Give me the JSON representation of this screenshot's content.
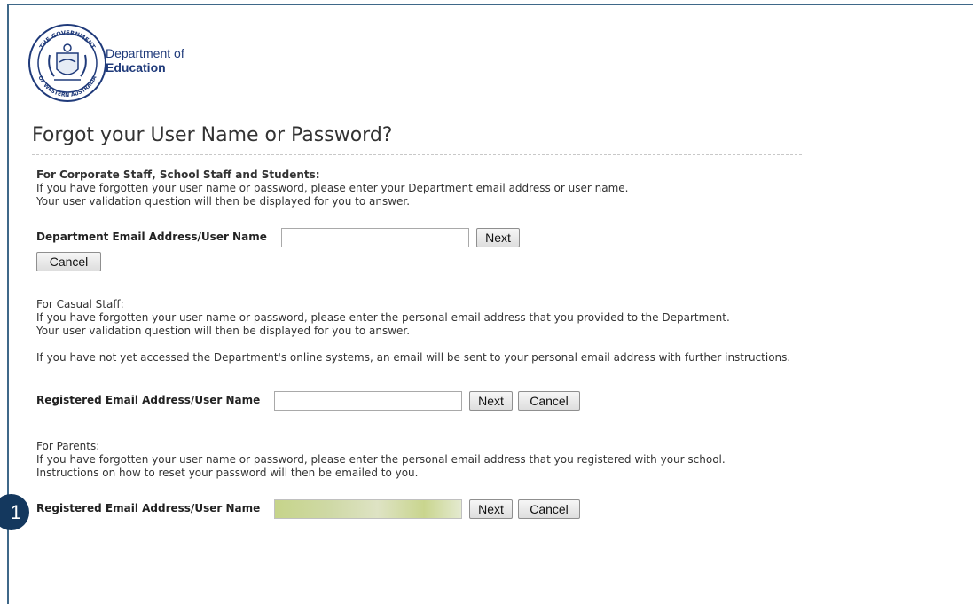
{
  "logo": {
    "line1": "Department of",
    "line2": "Education",
    "crest_top_text": "THE GOVERNMENT",
    "crest_bottom_text": "OF WESTERN AUSTRALIA"
  },
  "page_title": "Forgot your User Name or Password?",
  "corporate": {
    "heading": "For Corporate Staff, School Staff and Students:",
    "line1": "If you have forgotten your user name or password, please enter your Department email address or user name.",
    "line2": "Your user validation question will then be displayed for you to answer.",
    "field_label": "Department Email Address/User Name",
    "field_value": "",
    "next_label": "Next",
    "cancel_label": "Cancel"
  },
  "casual": {
    "heading": "For Casual Staff:",
    "line1": "If you have forgotten your user name or password, please enter the personal email address that you provided to the Department.",
    "line2": "Your user validation question will then be displayed for you to answer.",
    "line3": "If you have not yet accessed the Department's online systems, an email will be sent to your personal email address with further instructions.",
    "field_label": "Registered Email Address/User Name",
    "field_value": "",
    "next_label": "Next",
    "cancel_label": "Cancel"
  },
  "parents": {
    "heading": "For Parents:",
    "line1": "If you have forgotten your user name or password, please enter the personal email address that you registered with your school.",
    "line2": "Instructions on how to reset your password will then be emailed to you.",
    "field_label": "Registered Email Address/User Name",
    "field_value": "",
    "next_label": "Next",
    "cancel_label": "Cancel"
  },
  "step_badge": "1",
  "colors": {
    "frame": "#3f6889",
    "logo_text": "#1f3a7a",
    "badge": "#14385e",
    "blurred_field": "#cfd9a6"
  }
}
